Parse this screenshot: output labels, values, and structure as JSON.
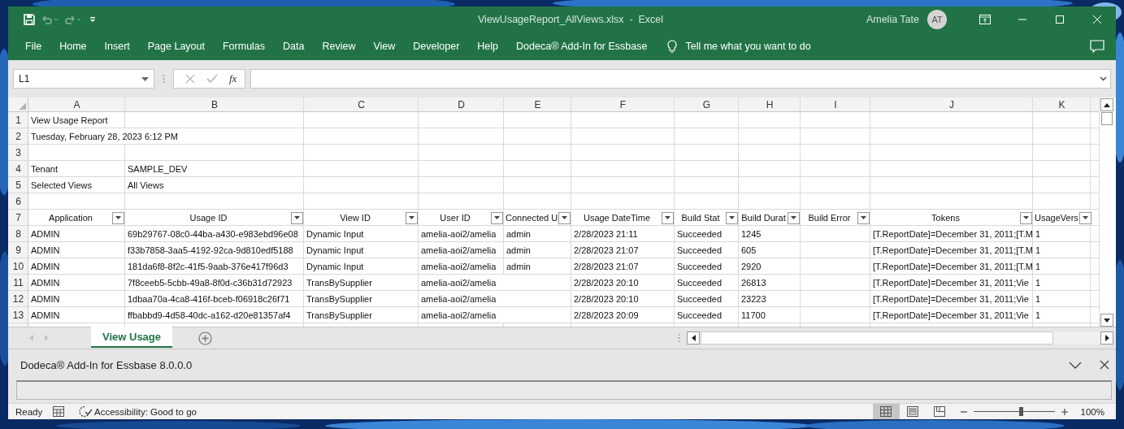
{
  "title_bar": {
    "quick_access": [
      {
        "kind": "save",
        "disabled": false
      },
      {
        "kind": "undo",
        "disabled": true
      },
      {
        "kind": "redo",
        "disabled": true
      },
      {
        "kind": "customize",
        "disabled": false
      }
    ],
    "title": "ViewUsageReport_AllViews.xlsx  -  Excel",
    "user": "Amelia Tate",
    "avatar": "AT"
  },
  "ribbon": {
    "tabs": [
      "File",
      "Home",
      "Insert",
      "Page Layout",
      "Formulas",
      "Data",
      "Review",
      "View",
      "Developer",
      "Help",
      "Dodeca® Add-In for Essbase"
    ],
    "tell_me": "Tell me what you want to do"
  },
  "formula_bar": {
    "name_box": "L1",
    "function_label": "fx"
  },
  "sheet": {
    "columns": [
      "A",
      "B",
      "C",
      "D",
      "E",
      "F",
      "G",
      "H",
      "I",
      "J",
      "K"
    ],
    "rows": [
      {
        "number": "1",
        "cells": {
          "A": {
            "kind": "text",
            "text": "View Usage Report"
          }
        }
      },
      {
        "number": "2",
        "cells": {
          "A": {
            "kind": "text",
            "text": "Tuesday, February 28, 2023  6:12 PM"
          }
        }
      },
      {
        "number": "3",
        "cells": {}
      },
      {
        "number": "4",
        "cells": {
          "A": {
            "kind": "text",
            "text": "Tenant"
          },
          "B": {
            "kind": "text",
            "text": "SAMPLE_DEV"
          }
        }
      },
      {
        "number": "5",
        "cells": {
          "A": {
            "kind": "text",
            "text": "Selected Views"
          },
          "B": {
            "kind": "text",
            "text": "All Views"
          }
        }
      },
      {
        "number": "6",
        "cells": {}
      },
      {
        "number": "7",
        "cells": {
          "A": {
            "kind": "filter",
            "text": "Application"
          },
          "B": {
            "kind": "filter",
            "text": "Usage ID"
          },
          "C": {
            "kind": "filter",
            "text": "View ID"
          },
          "D": {
            "kind": "filter",
            "text": "User ID"
          },
          "E": {
            "kind": "filter",
            "text": "Connected U"
          },
          "F": {
            "kind": "filter",
            "text": "Usage DateTime"
          },
          "G": {
            "kind": "filter",
            "text": "Build Stat"
          },
          "H": {
            "kind": "filter",
            "text": "Build Durat"
          },
          "I": {
            "kind": "filter",
            "text": "Build Error"
          },
          "J": {
            "kind": "filter",
            "text": "Tokens"
          },
          "K": {
            "kind": "filter",
            "text": "UsageVers"
          }
        }
      },
      {
        "number": "8",
        "cells": {
          "A": {
            "kind": "text",
            "text": "ADMIN"
          },
          "B": {
            "kind": "text",
            "text": "69b29767-08c0-44ba-a430-e983ebd96e08"
          },
          "C": {
            "kind": "text",
            "text": "Dynamic Input"
          },
          "D": {
            "kind": "text",
            "text": "amelia-aoi2/amelia"
          },
          "E": {
            "kind": "text",
            "text": "admin"
          },
          "F": {
            "kind": "text",
            "text": "2/28/2023 21:11"
          },
          "G": {
            "kind": "text",
            "text": "Succeeded"
          },
          "H": {
            "kind": "text",
            "text": "1245"
          },
          "J": {
            "kind": "text",
            "text": "[T.ReportDate]=December 31, 2011;[T.M"
          },
          "K": {
            "kind": "text",
            "text": "1"
          }
        }
      },
      {
        "number": "9",
        "cells": {
          "A": {
            "kind": "text",
            "text": "ADMIN"
          },
          "B": {
            "kind": "text",
            "text": "f33b7858-3aa5-4192-92ca-9d810edf5188"
          },
          "C": {
            "kind": "text",
            "text": "Dynamic Input"
          },
          "D": {
            "kind": "text",
            "text": "amelia-aoi2/amelia"
          },
          "E": {
            "kind": "text",
            "text": "admin"
          },
          "F": {
            "kind": "text",
            "text": "2/28/2023 21:07"
          },
          "G": {
            "kind": "text",
            "text": "Succeeded"
          },
          "H": {
            "kind": "text",
            "text": "605"
          },
          "J": {
            "kind": "text",
            "text": "[T.ReportDate]=December 31, 2011;[T.M"
          },
          "K": {
            "kind": "text",
            "text": "1"
          }
        }
      },
      {
        "number": "10",
        "cells": {
          "A": {
            "kind": "text",
            "text": "ADMIN"
          },
          "B": {
            "kind": "text",
            "text": "181da6f8-8f2c-41f5-9aab-376e417f96d3"
          },
          "C": {
            "kind": "text",
            "text": "Dynamic Input"
          },
          "D": {
            "kind": "text",
            "text": "amelia-aoi2/amelia"
          },
          "E": {
            "kind": "text",
            "text": "admin"
          },
          "F": {
            "kind": "text",
            "text": "2/28/2023 21:07"
          },
          "G": {
            "kind": "text",
            "text": "Succeeded"
          },
          "H": {
            "kind": "text",
            "text": "2920"
          },
          "J": {
            "kind": "text",
            "text": "[T.ReportDate]=December 31, 2011;[T.M"
          },
          "K": {
            "kind": "text",
            "text": "1"
          }
        }
      },
      {
        "number": "11",
        "cells": {
          "A": {
            "kind": "text",
            "text": "ADMIN"
          },
          "B": {
            "kind": "text",
            "text": "7f8ceeb5-5cbb-49a8-8f0d-c36b31d72923"
          },
          "C": {
            "kind": "text",
            "text": "TransBySupplier"
          },
          "D": {
            "kind": "text",
            "text": "amelia-aoi2/amelia"
          },
          "F": {
            "kind": "text",
            "text": "2/28/2023 20:10"
          },
          "G": {
            "kind": "text",
            "text": "Succeeded"
          },
          "H": {
            "kind": "text",
            "text": "26813"
          },
          "J": {
            "kind": "text",
            "text": "[T.ReportDate]=December 31, 2011;Vie"
          },
          "K": {
            "kind": "text",
            "text": "1"
          }
        }
      },
      {
        "number": "12",
        "cells": {
          "A": {
            "kind": "text",
            "text": "ADMIN"
          },
          "B": {
            "kind": "text",
            "text": "1dbaa70a-4ca8-416f-bceb-f06918c26f71"
          },
          "C": {
            "kind": "text",
            "text": "TransBySupplier"
          },
          "D": {
            "kind": "text",
            "text": "amelia-aoi2/amelia"
          },
          "F": {
            "kind": "text",
            "text": "2/28/2023 20:10"
          },
          "G": {
            "kind": "text",
            "text": "Succeeded"
          },
          "H": {
            "kind": "text",
            "text": "23223"
          },
          "J": {
            "kind": "text",
            "text": "[T.ReportDate]=December 31, 2011;Vie"
          },
          "K": {
            "kind": "text",
            "text": "1"
          }
        }
      },
      {
        "number": "13",
        "cells": {
          "A": {
            "kind": "text",
            "text": "ADMIN"
          },
          "B": {
            "kind": "text",
            "text": "ffbabbd9-4d58-40dc-a162-d20e81357af4"
          },
          "C": {
            "kind": "text",
            "text": "TransBySupplier"
          },
          "D": {
            "kind": "text",
            "text": "amelia-aoi2/amelia"
          },
          "F": {
            "kind": "text",
            "text": "2/28/2023 20:09"
          },
          "G": {
            "kind": "text",
            "text": "Succeeded"
          },
          "H": {
            "kind": "text",
            "text": "11700"
          },
          "J": {
            "kind": "text",
            "text": "[T.ReportDate]=December 31, 2011;Vie"
          },
          "K": {
            "kind": "text",
            "text": "1"
          }
        }
      }
    ]
  },
  "sheet_tabs": [
    {
      "label": "View Usage",
      "selected": true
    }
  ],
  "add_in_pane": {
    "title": "Dodeca® Add-In for Essbase 8.0.0.0"
  },
  "status_bar": {
    "mode": "Ready",
    "accessibility": "Accessibility: Good to go",
    "views": [
      {
        "kind": "normal",
        "selected": true
      },
      {
        "kind": "page_layout",
        "selected": false
      },
      {
        "kind": "page_break",
        "selected": false
      }
    ],
    "zoom": {
      "level": 0.58,
      "reading": "100%"
    }
  }
}
